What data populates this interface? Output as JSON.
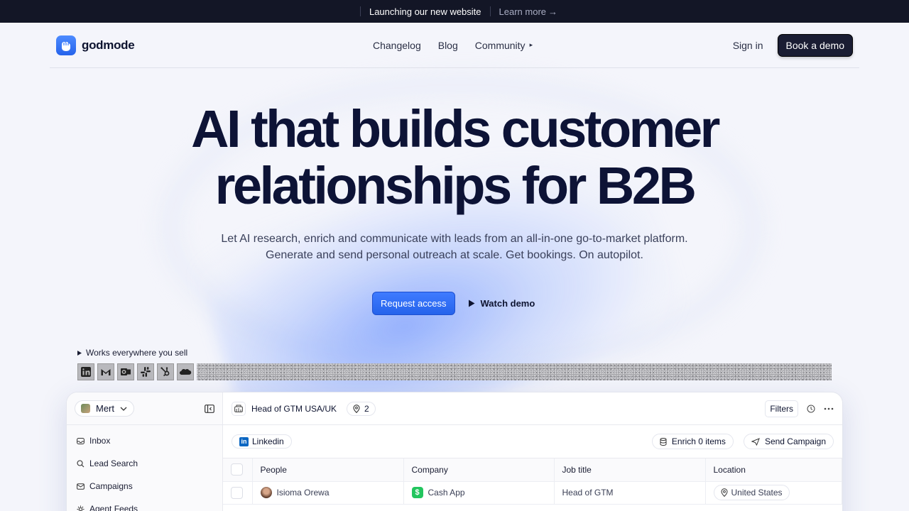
{
  "announcement": {
    "text": "Launching our new website",
    "link": "Learn more",
    "arrow": "→"
  },
  "nav": {
    "logo_text": "godmode",
    "links": [
      "Changelog",
      "Blog",
      "Community"
    ],
    "community_caret": "▸",
    "signin": "Sign in",
    "book_demo": "Book a demo"
  },
  "hero": {
    "title_line1": "AI that builds customer",
    "title_line2": "relationships for B2B",
    "subtitle_line1": "Let AI research, enrich and communicate with leads from an all-in-one go-to-market platform.",
    "subtitle_line2": "Generate and send personal outreach at scale. Get bookings. On autopilot.",
    "request_access": "Request access",
    "watch_demo": "Watch demo"
  },
  "integrations": {
    "label": "Works everywhere you sell",
    "icons": [
      "linkedin-icon",
      "gmail-icon",
      "outlook-icon",
      "slack-icon",
      "hubspot-icon",
      "salesforce-icon"
    ]
  },
  "app": {
    "user": "Mert",
    "sidebar_items": [
      "Inbox",
      "Lead Search",
      "Campaigns",
      "Agent Feeds"
    ],
    "search_title": "Head of GTM USA/UK",
    "location_count": "2",
    "filters": "Filters",
    "source_chip": "Linkedin",
    "enrich": "Enrich 0 items",
    "send_campaign": "Send Campaign",
    "columns": [
      "People",
      "Company",
      "Job title",
      "Location"
    ],
    "rows": [
      {
        "person": "Isioma Orewa",
        "company": "Cash App",
        "job": "Head of GTM",
        "location": "United States"
      }
    ]
  },
  "colors": {
    "accent": "#2563eb",
    "dark": "#131626",
    "title": "#0d1336"
  }
}
